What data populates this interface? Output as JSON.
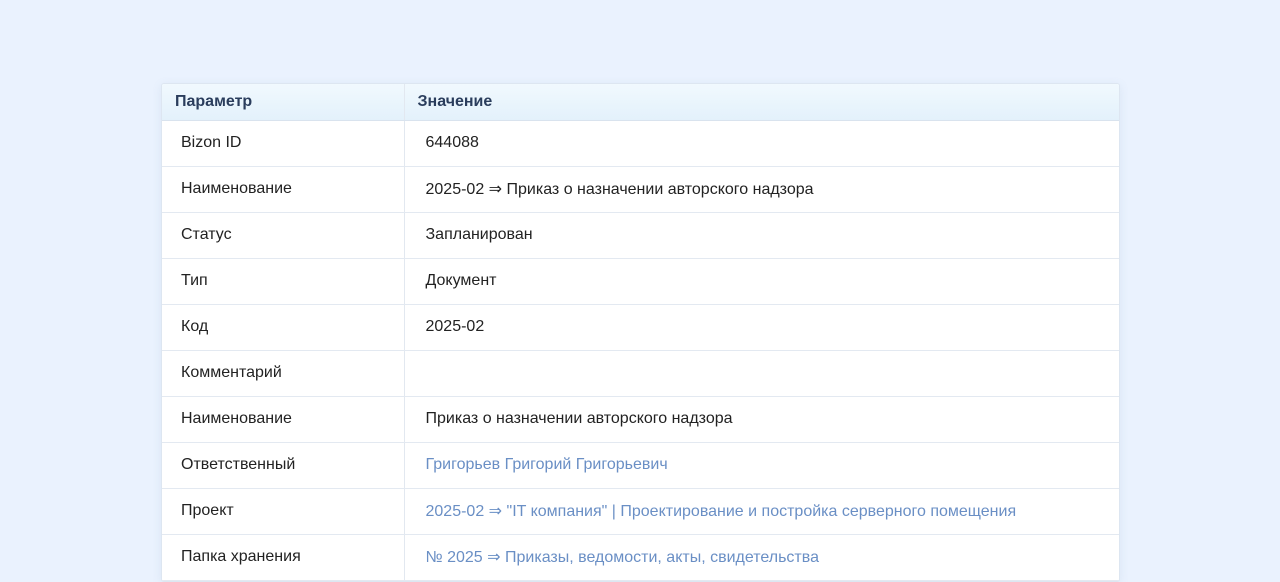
{
  "table": {
    "headers": {
      "param": "Параметр",
      "value": "Значение"
    },
    "rows": [
      {
        "param": "Bizon ID",
        "value": "644088",
        "is_link": false
      },
      {
        "param": "Наименование",
        "value": "2025-02 ⇒ Приказ о назначении авторского надзора",
        "is_link": false
      },
      {
        "param": "Статус",
        "value": "Запланирован",
        "is_link": false
      },
      {
        "param": "Тип",
        "value": "Документ",
        "is_link": false
      },
      {
        "param": "Код",
        "value": "2025-02",
        "is_link": false
      },
      {
        "param": "Комментарий",
        "value": "",
        "is_link": false
      },
      {
        "param": "Наименование",
        "value": "Приказ о назначении авторского надзора",
        "is_link": false
      },
      {
        "param": "Ответственный",
        "value": "Григорьев Григорий Григорьевич",
        "is_link": true
      },
      {
        "param": "Проект",
        "value": "2025-02 ⇒ \"IT компания\" | Проектирование и постройка серверного помещения",
        "is_link": true
      },
      {
        "param": "Папка хранения",
        "value": "№ 2025 ⇒ Приказы, ведомости, акты, свидетельства",
        "is_link": true
      }
    ]
  },
  "colors": {
    "page_background": "#eaf2fe",
    "header_text": "#2a3d5c",
    "link": "#6a8fc5",
    "text": "#222222"
  }
}
